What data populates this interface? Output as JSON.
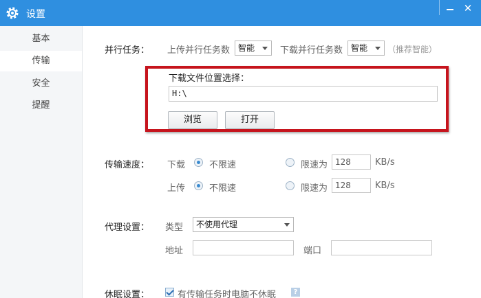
{
  "window": {
    "title": "设置"
  },
  "sidebar": {
    "items": [
      {
        "label": "基本"
      },
      {
        "label": "传输"
      },
      {
        "label": "安全"
      },
      {
        "label": "提醒"
      }
    ]
  },
  "parallel": {
    "label": "并行任务：",
    "upload_label": "上传并行任务数",
    "upload_value": "智能",
    "download_label": "下载并行任务数",
    "download_value": "智能",
    "hint": "（推荐智能）"
  },
  "download_location": {
    "label": "下载文件位置选择：",
    "path": "H:\\",
    "browse_label": "浏览",
    "open_label": "打开"
  },
  "speed": {
    "label": "传输速度：",
    "download": {
      "label": "下载",
      "unlimited_label": "不限速",
      "limited_label": "限速为",
      "value": "128",
      "unit": "KB/s",
      "unlimited_selected": true
    },
    "upload": {
      "label": "上传",
      "unlimited_label": "不限速",
      "limited_label": "限速为",
      "value": "128",
      "unit": "KB/s",
      "unlimited_selected": true
    }
  },
  "proxy": {
    "label": "代理设置：",
    "type_label": "类型",
    "type_value": "不使用代理",
    "address_label": "地址",
    "address_value": "",
    "port_label": "端口",
    "port_value": ""
  },
  "sleep": {
    "label": "休眠设置：",
    "checkbox_label": "有传输任务时电脑不休眠",
    "checked": true,
    "help": "?"
  },
  "colors": {
    "titlebar": "#2f8fe0",
    "highlight": "#c6141d",
    "sidebar": "#f4f6f8"
  }
}
